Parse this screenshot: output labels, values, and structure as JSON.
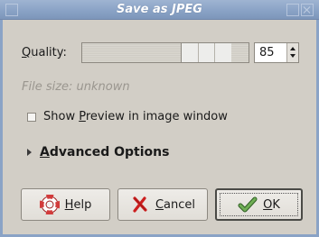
{
  "window": {
    "title": "Save as JPEG"
  },
  "quality": {
    "label_prefix": "",
    "label_mnemonic": "Q",
    "label_rest": "uality:",
    "value": "85",
    "level": 0.85
  },
  "file_size": {
    "text": "File size: unknown"
  },
  "preview_option": {
    "label_before": "Show ",
    "label_mnemonic": "P",
    "label_after": "review in image window",
    "checked": false
  },
  "advanced": {
    "label_mnemonic": "A",
    "label_rest": "dvanced Options",
    "expanded": false
  },
  "buttons": {
    "help": {
      "mnemonic": "H",
      "rest": "elp",
      "icon": "lifebuoy-icon"
    },
    "cancel": {
      "mnemonic": "C",
      "rest": "ancel",
      "icon": "red-x-icon"
    },
    "ok": {
      "mnemonic": "O",
      "rest": "K",
      "icon": "green-check-icon"
    }
  },
  "colors": {
    "titlebar": "#8aa3c6",
    "dialog_bg": "#d2cec6",
    "help_icon": "#d23b3b",
    "cancel_icon": "#cc1f1f",
    "ok_icon": "#4c8a3a"
  }
}
